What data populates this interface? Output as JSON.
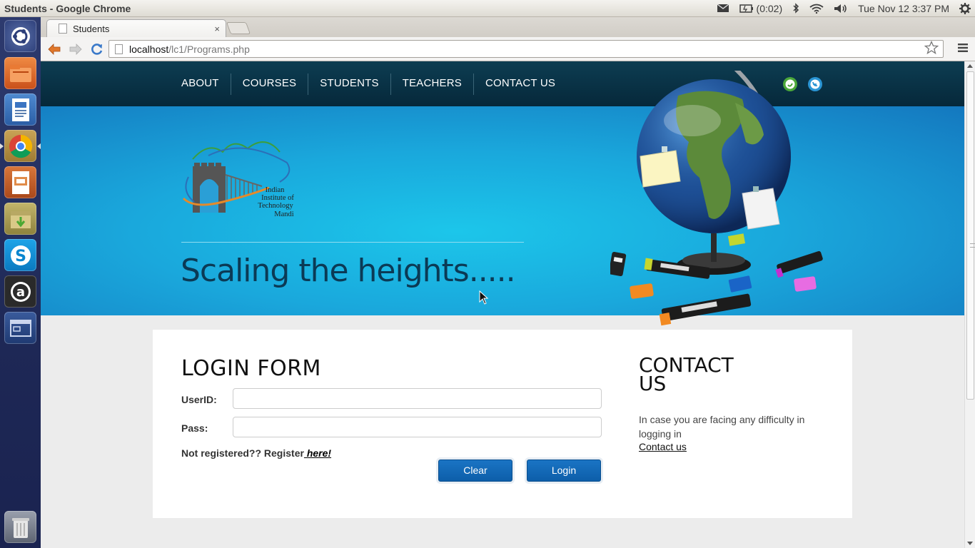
{
  "top_panel": {
    "window_title": "Students - Google Chrome",
    "battery": "(0:02)",
    "datetime": "Tue Nov 12  3:37 PM",
    "icons": [
      "mail-icon",
      "battery-icon",
      "bluetooth-icon",
      "wifi-icon",
      "volume-icon",
      "settings-gear-icon"
    ]
  },
  "launcher": {
    "items": [
      "ubuntu-dash-icon",
      "files-icon",
      "writer-icon",
      "chrome-icon",
      "impress-icon",
      "archive-icon",
      "skype-icon",
      "amazon-icon",
      "workspace-icon",
      "trash-icon"
    ]
  },
  "browser": {
    "tab_title": "Students",
    "tab_close": "×",
    "url_host": "localhost",
    "url_path": "/lc1/Programs.php"
  },
  "site": {
    "nav": [
      "ABOUT",
      "COURSES",
      "STUDENTS",
      "TEACHERS",
      "CONTACT US"
    ],
    "logo_lines": [
      "Indian",
      "Institute of",
      "Technology",
      "Mandi"
    ],
    "tagline": "Scaling the heights.....",
    "login": {
      "title": "LOGIN FORM",
      "userid_label": "UserID:",
      "pass_label": "Pass:",
      "userid_value": "",
      "pass_value": "",
      "register_text": "Not registered?? Register",
      "register_link": " here!",
      "clear_label": "Clear",
      "login_label": "Login"
    },
    "contact": {
      "title_line1": "CONTACT",
      "title_line2": "US",
      "text": "In case you are facing any difficulty in logging in",
      "link": "Contact us"
    }
  },
  "colors": {
    "nav_bg": "#0d3d52",
    "hero_bg": "#1aa8dc",
    "button_bg": "#0d5ea9",
    "launcher_bg": "#1e2856"
  }
}
